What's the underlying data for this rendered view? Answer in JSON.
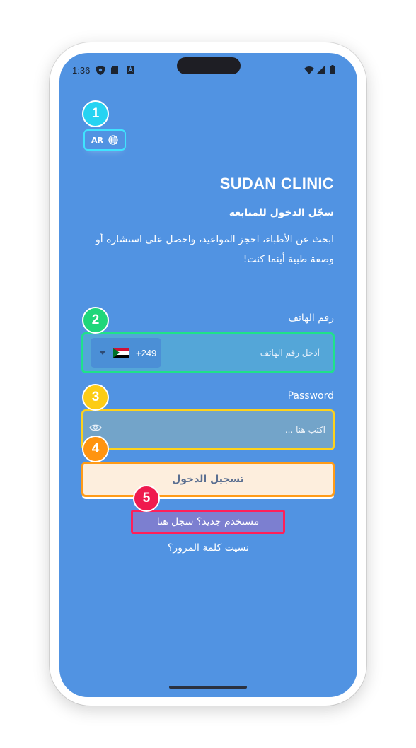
{
  "status_bar": {
    "time": "1:36"
  },
  "lang_toggle": {
    "code": "AR"
  },
  "app": {
    "name": "SUDAN CLINIC",
    "subtitle": "سجّل الدخول للمتابعة",
    "description": "ابحث عن الأطباء، احجز المواعيد، واحصل على استشارة أو وصفة طبية أينما كنت!"
  },
  "phone": {
    "label": "رقم الهاتف",
    "dial_code": "+249",
    "placeholder": "أدخل رقم الهاتف"
  },
  "password": {
    "label": "Password",
    "placeholder": "اكتب هنا ..."
  },
  "actions": {
    "login_label": "تسجيل الدخول",
    "register_label": "مستخدم جديد؟ سجل هنا",
    "forgot_label": "نسيت كلمة المرور؟"
  },
  "annotations": [
    {
      "number": "1",
      "color": "#26d3f2"
    },
    {
      "number": "2",
      "color": "#1fd67a"
    },
    {
      "number": "3",
      "color": "#fccc16"
    },
    {
      "number": "4",
      "color": "#ff9410"
    },
    {
      "number": "5",
      "color": "#ef1a4e"
    }
  ]
}
